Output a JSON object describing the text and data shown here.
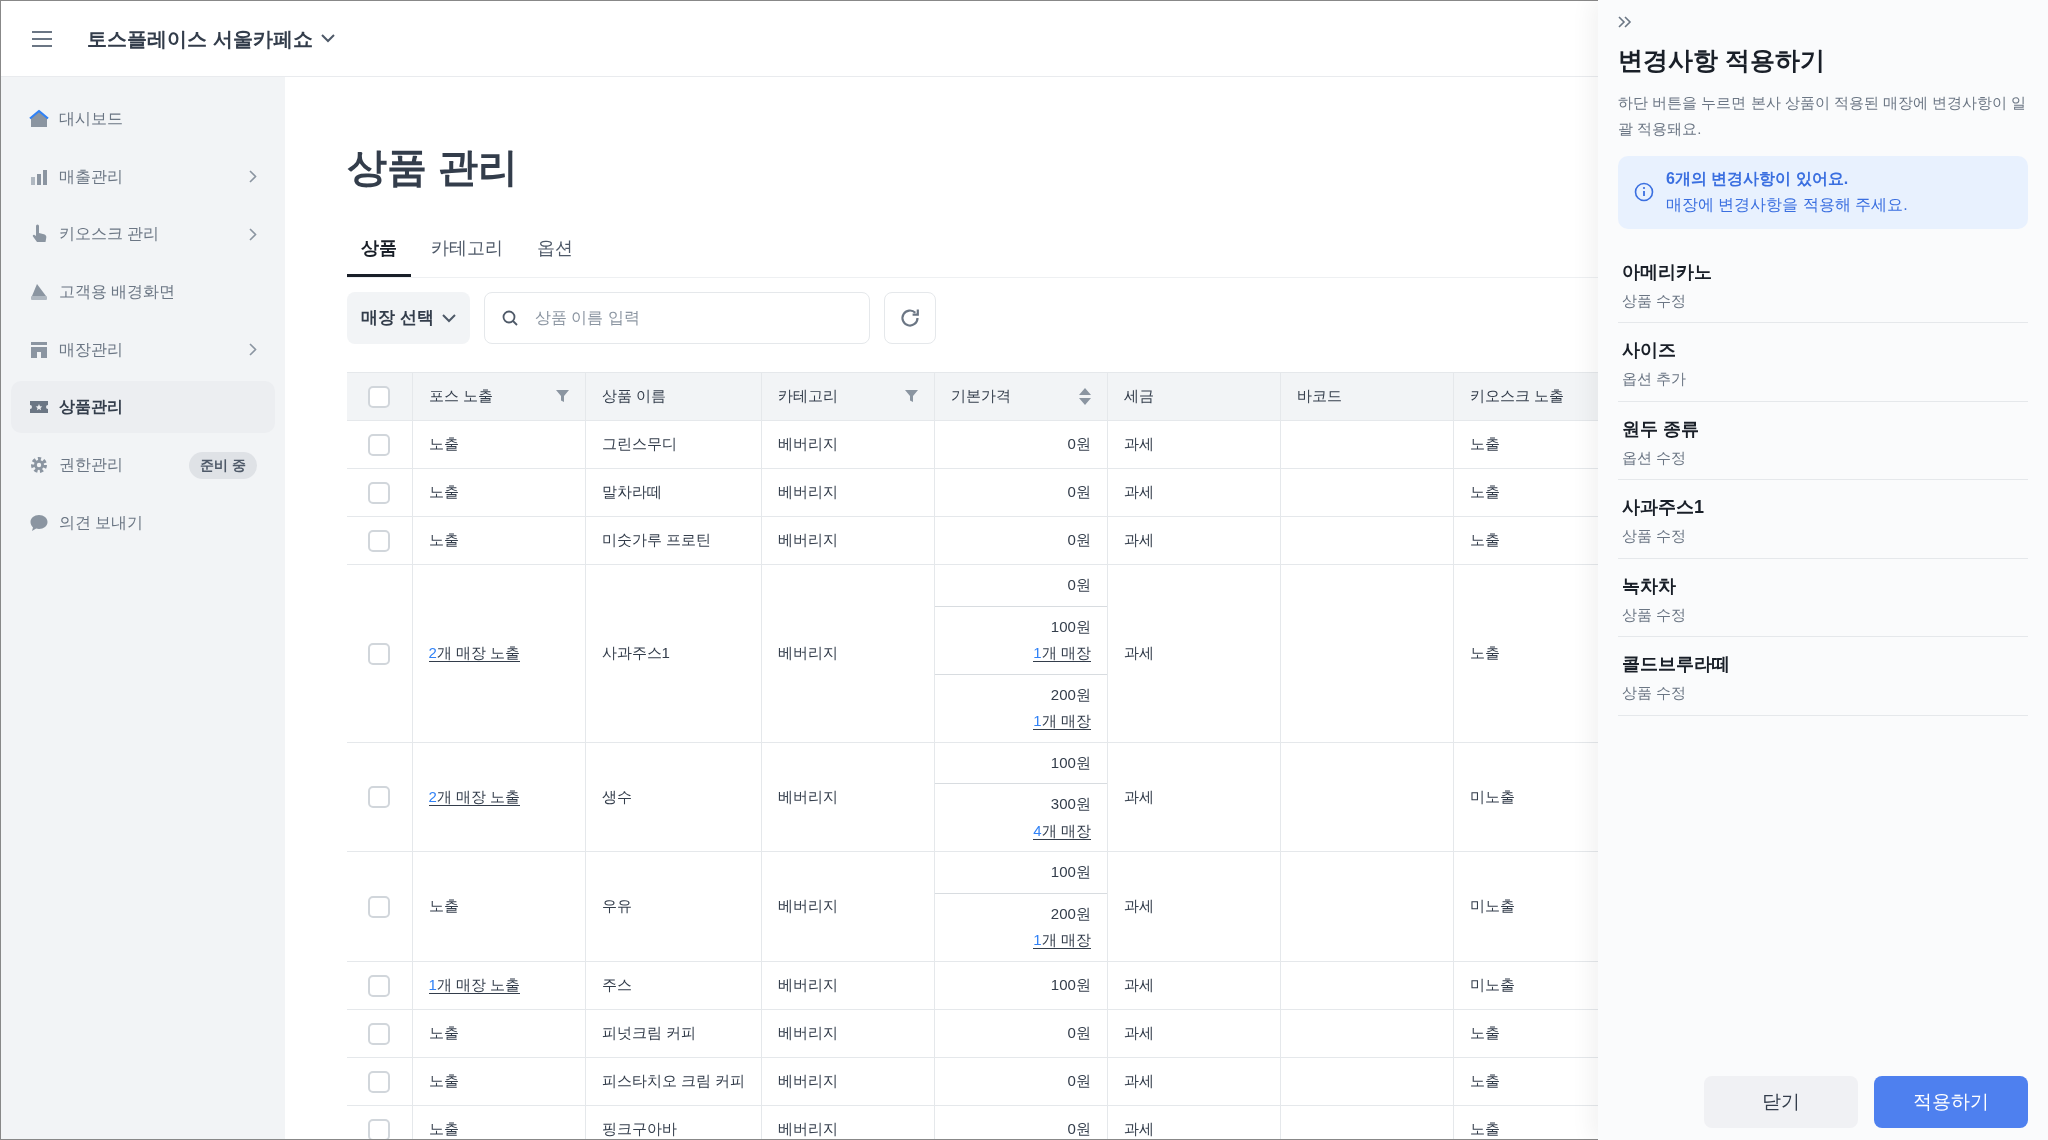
{
  "header": {
    "store_name": "토스플레이스 서울카페쇼"
  },
  "sidebar": {
    "items": [
      {
        "label": "대시보드",
        "selected": false,
        "has_submenu": false
      },
      {
        "label": "매출관리",
        "selected": false,
        "has_submenu": true
      },
      {
        "label": "키오스크 관리",
        "selected": false,
        "has_submenu": true
      },
      {
        "label": "고객용 배경화면",
        "selected": false,
        "has_submenu": false
      },
      {
        "label": "매장관리",
        "selected": false,
        "has_submenu": true
      },
      {
        "label": "상품관리",
        "selected": true,
        "has_submenu": false
      },
      {
        "label": "권한관리",
        "selected": false,
        "has_submenu": false,
        "badge": "준비 중"
      },
      {
        "label": "의견 보내기",
        "selected": false,
        "has_submenu": false
      }
    ]
  },
  "page_title": "상품 관리",
  "tabs": [
    {
      "label": "상품",
      "selected": true
    },
    {
      "label": "카테고리",
      "selected": false
    },
    {
      "label": "옵션",
      "selected": false
    }
  ],
  "toolbar": {
    "store_select": "매장 선택",
    "search": {
      "placeholder": "상품 이름 입력"
    }
  },
  "table": {
    "all_checked": false,
    "columns": [
      {
        "label": "포스 노출",
        "filterable": true,
        "sortable": false
      },
      {
        "label": "상품 이름",
        "filterable": false,
        "sortable": false
      },
      {
        "label": "카테고리",
        "filterable": true,
        "sortable": false
      },
      {
        "label": "기본가격",
        "filterable": false,
        "sortable": true
      },
      {
        "label": "세금",
        "filterable": false,
        "sortable": false
      },
      {
        "label": "바코드",
        "filterable": false,
        "sortable": false
      },
      {
        "label": "키오스크 노출",
        "filterable": false,
        "sortable": false
      }
    ],
    "rows": [
      {
        "checked": false,
        "pos": {
          "text": "노출"
        },
        "name": "그린스무디",
        "category": "베버리지",
        "prices": [
          {
            "amount": "0원"
          }
        ],
        "tax": "과세",
        "kiosk": "노출"
      },
      {
        "checked": false,
        "pos": {
          "text": "노출"
        },
        "name": "말차라떼",
        "category": "베버리지",
        "prices": [
          {
            "amount": "0원"
          }
        ],
        "tax": "과세",
        "kiosk": "노출"
      },
      {
        "checked": false,
        "pos": {
          "text": "노출"
        },
        "name": "미숫가루 프로틴",
        "category": "베버리지",
        "prices": [
          {
            "amount": "0원"
          }
        ],
        "tax": "과세",
        "kiosk": "노출"
      },
      {
        "checked": false,
        "pos": {
          "count": "2",
          "text": "개 매장 노출"
        },
        "name": "사과주스1",
        "category": "베버리지",
        "prices": [
          {
            "amount": "0원"
          },
          {
            "amount": "100원",
            "stores": {
              "count": "1",
              "text": "개 매장"
            }
          },
          {
            "amount": "200원",
            "stores": {
              "count": "1",
              "text": "개 매장"
            }
          }
        ],
        "tax": "과세",
        "kiosk": "노출"
      },
      {
        "checked": false,
        "pos": {
          "count": "2",
          "text": "개 매장 노출"
        },
        "name": "생수",
        "category": "베버리지",
        "prices": [
          {
            "amount": "100원"
          },
          {
            "amount": "300원",
            "stores": {
              "count": "4",
              "text": "개 매장"
            }
          }
        ],
        "tax": "과세",
        "kiosk": "미노출"
      },
      {
        "checked": false,
        "pos": {
          "text": "노출"
        },
        "name": "우유",
        "category": "베버리지",
        "prices": [
          {
            "amount": "100원"
          },
          {
            "amount": "200원",
            "stores": {
              "count": "1",
              "text": "개 매장"
            }
          }
        ],
        "tax": "과세",
        "kiosk": "미노출"
      },
      {
        "checked": false,
        "pos": {
          "count": "1",
          "text": "개 매장 노출"
        },
        "name": "주스",
        "category": "베버리지",
        "prices": [
          {
            "amount": "100원"
          }
        ],
        "tax": "과세",
        "kiosk": "미노출"
      },
      {
        "checked": false,
        "pos": {
          "text": "노출"
        },
        "name": "피넛크림 커피",
        "category": "베버리지",
        "prices": [
          {
            "amount": "0원"
          }
        ],
        "tax": "과세",
        "kiosk": "노출"
      },
      {
        "checked": false,
        "pos": {
          "text": "노출"
        },
        "name": "피스타치오 크림 커피",
        "category": "베버리지",
        "prices": [
          {
            "amount": "0원"
          }
        ],
        "tax": "과세",
        "kiosk": "노출"
      },
      {
        "checked": false,
        "pos": {
          "text": "노출"
        },
        "name": "핑크구아바",
        "category": "베버리지",
        "prices": [
          {
            "amount": "0원"
          }
        ],
        "tax": "과세",
        "kiosk": "노출"
      }
    ]
  },
  "panel": {
    "title": "변경사항 적용하기",
    "description": "하단 버튼을 누르면 본사 상품이 적용된 매장에 변경사항이 일괄 적용돼요.",
    "notice": {
      "headline": "6개의 변경사항이 있어요.",
      "text": "매장에 변경사항을 적용해 주세요."
    },
    "changes": [
      {
        "name": "아메리카노",
        "type": "상품 수정"
      },
      {
        "name": "사이즈",
        "type": "옵션 추가"
      },
      {
        "name": "원두 종류",
        "type": "옵션 수정"
      },
      {
        "name": "사과주스1",
        "type": "상품 수정"
      },
      {
        "name": "녹차차",
        "type": "상품 수정"
      },
      {
        "name": "콜드브루라떼",
        "type": "상품 수정"
      }
    ],
    "buttons": {
      "close": "닫기",
      "apply": "적용하기"
    }
  }
}
